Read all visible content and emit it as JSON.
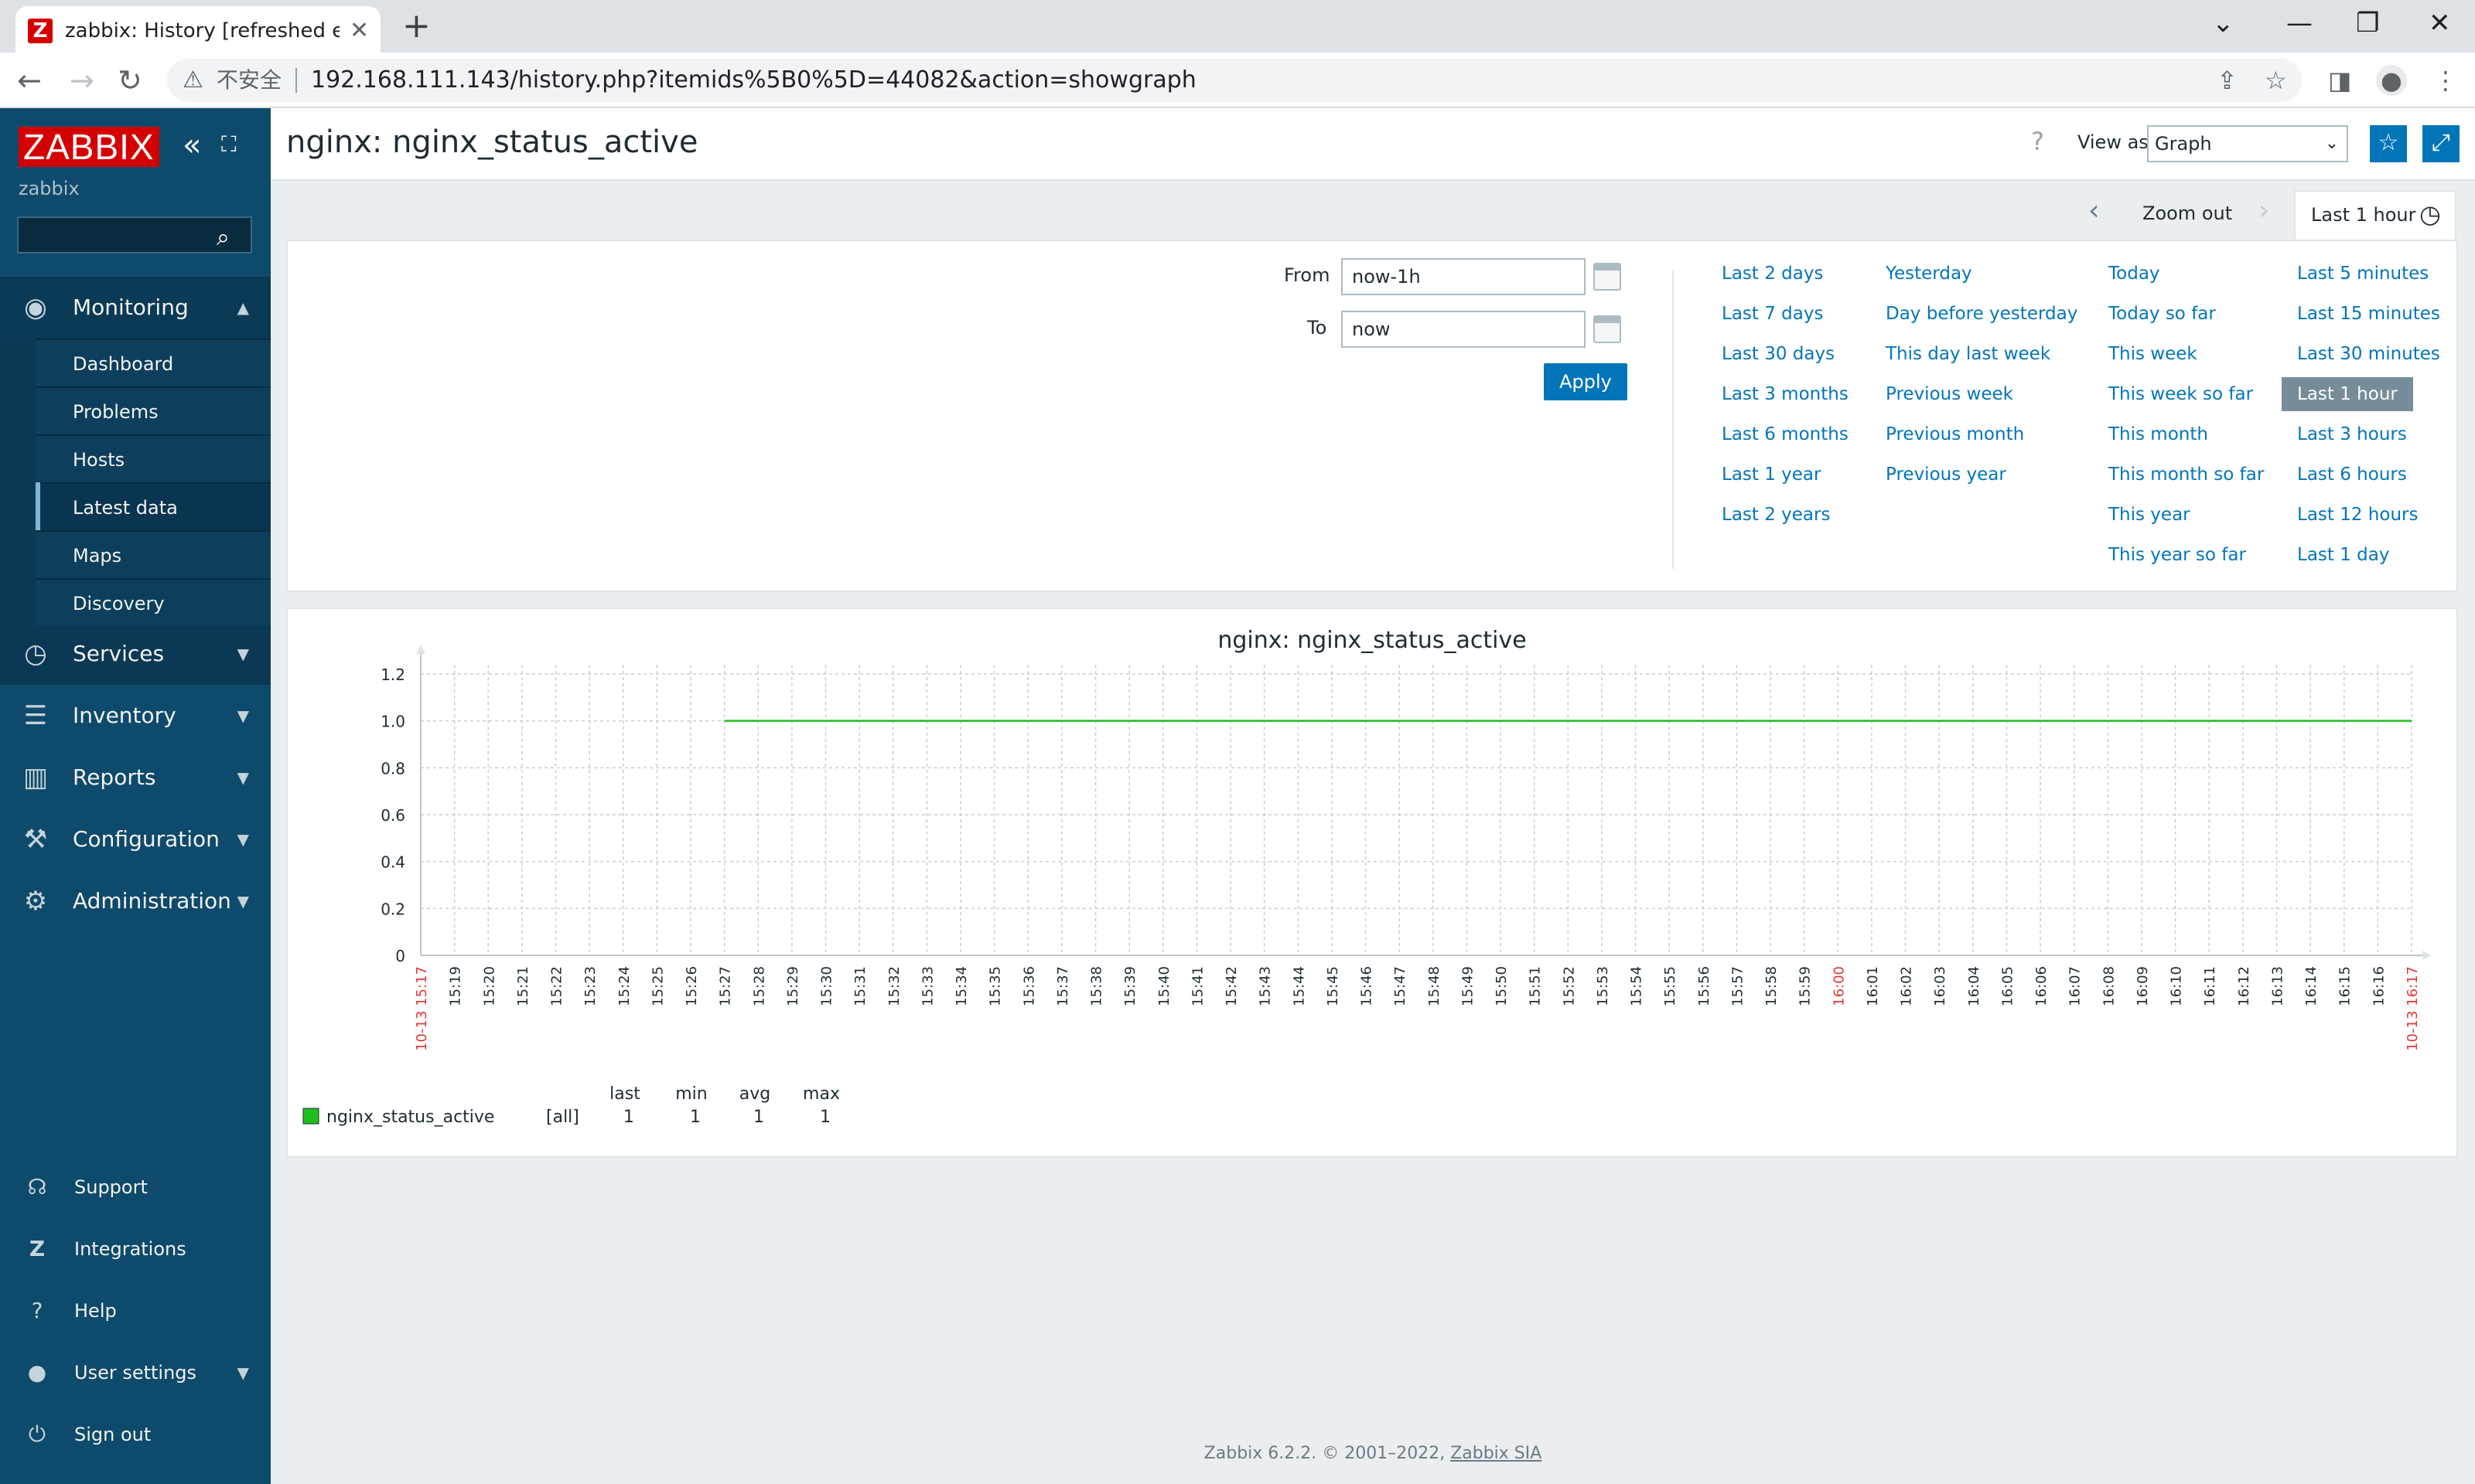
{
  "browser": {
    "tab_title": "zabbix: History [refreshed every",
    "favicon_letter": "Z",
    "insecure_label": "不安全",
    "url": "192.168.111.143/history.php?itemids%5B0%5D=44082&action=showgraph"
  },
  "sidebar": {
    "logo": "ZABBIX",
    "server_name": "zabbix",
    "search_placeholder": "",
    "menu": [
      {
        "label": "Monitoring",
        "icon": "eye-icon"
      },
      {
        "label": "Services",
        "icon": "clock-icon"
      },
      {
        "label": "Inventory",
        "icon": "list-icon"
      },
      {
        "label": "Reports",
        "icon": "bar-chart-icon"
      },
      {
        "label": "Configuration",
        "icon": "wrench-icon"
      },
      {
        "label": "Administration",
        "icon": "gear-icon"
      }
    ],
    "submenu": [
      "Dashboard",
      "Problems",
      "Hosts",
      "Latest data",
      "Maps",
      "Discovery"
    ],
    "selected_submenu": "Latest data",
    "bottom": [
      {
        "label": "Support",
        "icon": "headset-icon"
      },
      {
        "label": "Integrations",
        "icon": "zabbix-z-icon"
      },
      {
        "label": "Help",
        "icon": "question-icon"
      },
      {
        "label": "User settings",
        "icon": "user-icon"
      },
      {
        "label": "Sign out",
        "icon": "power-icon"
      }
    ]
  },
  "header": {
    "title": "nginx: nginx_status_active",
    "view_as_label": "View as",
    "view_as_value": "Graph"
  },
  "time_nav": {
    "zoom_out": "Zoom out",
    "tab_label": "Last 1 hour"
  },
  "filter": {
    "from_label": "From",
    "from_value": "now-1h",
    "to_label": "To",
    "to_value": "now",
    "apply": "Apply",
    "quick_ranges": [
      [
        "Last 2 days",
        "Last 7 days",
        "Last 30 days",
        "Last 3 months",
        "Last 6 months",
        "Last 1 year",
        "Last 2 years"
      ],
      [
        "Yesterday",
        "Day before yesterday",
        "This day last week",
        "Previous week",
        "Previous month",
        "Previous year"
      ],
      [
        "Today",
        "Today so far",
        "This week",
        "This week so far",
        "This month",
        "This month so far",
        "This year",
        "This year so far"
      ],
      [
        "Last 5 minutes",
        "Last 15 minutes",
        "Last 30 minutes",
        "Last 1 hour",
        "Last 3 hours",
        "Last 6 hours",
        "Last 12 hours",
        "Last 1 day"
      ]
    ],
    "selected_range": "Last 1 hour"
  },
  "chart_data": {
    "type": "line",
    "title": "nginx: nginx_status_active",
    "ylim": [
      0,
      1.2
    ],
    "y_ticks": [
      "0",
      "0.2",
      "0.4",
      "0.6",
      "0.8",
      "1.0",
      "1.2"
    ],
    "x_ticks": [
      "10-13 15:17",
      "15:19",
      "15:20",
      "15:21",
      "15:22",
      "15:23",
      "15:24",
      "15:25",
      "15:26",
      "15:27",
      "15:28",
      "15:29",
      "15:30",
      "15:31",
      "15:32",
      "15:33",
      "15:34",
      "15:35",
      "15:36",
      "15:37",
      "15:38",
      "15:39",
      "15:40",
      "15:41",
      "15:42",
      "15:43",
      "15:44",
      "15:45",
      "15:46",
      "15:47",
      "15:48",
      "15:49",
      "15:50",
      "15:51",
      "15:52",
      "15:53",
      "15:54",
      "15:55",
      "15:56",
      "15:57",
      "15:58",
      "15:59",
      "16:00",
      "16:01",
      "16:02",
      "16:03",
      "16:04",
      "16:05",
      "16:06",
      "16:07",
      "16:08",
      "16:09",
      "16:10",
      "16:11",
      "16:12",
      "16:13",
      "16:14",
      "16:15",
      "16:16",
      "10-13 16:17"
    ],
    "highlight_ticks": [
      "10-13 15:17",
      "16:00",
      "10-13 16:17"
    ],
    "highlight_color": "#e33734",
    "series": [
      {
        "name": "nginx_status_active",
        "color": "#1fbf1f",
        "x": [
          "15:27",
          "16:17"
        ],
        "values": [
          1,
          1
        ]
      }
    ],
    "legend": {
      "headers": [
        "last",
        "min",
        "avg",
        "max"
      ],
      "rows": [
        {
          "name": "nginx_status_active",
          "func": "[all]",
          "last": "1",
          "min": "1",
          "avg": "1",
          "max": "1"
        }
      ]
    }
  },
  "footer": {
    "text": "Zabbix 6.2.2. © 2001–2022, ",
    "link": "Zabbix SIA"
  }
}
